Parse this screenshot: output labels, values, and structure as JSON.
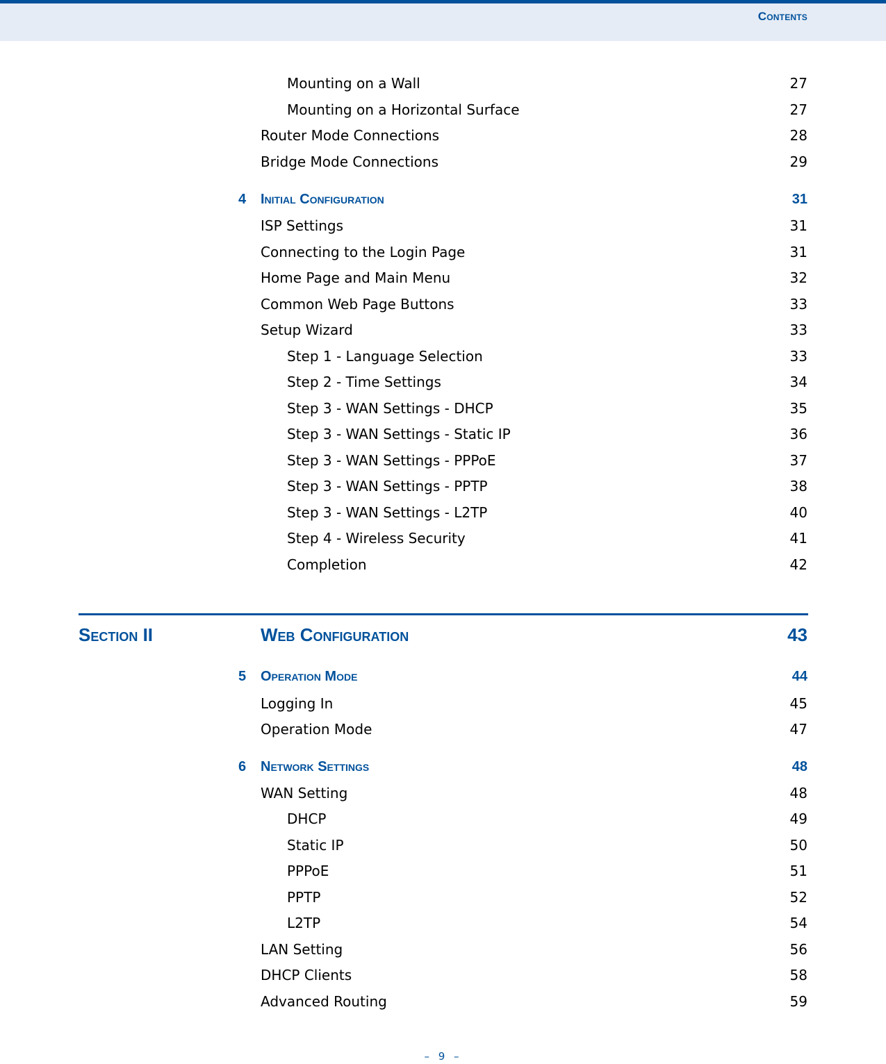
{
  "header": {
    "title": "Contents"
  },
  "toc_top": [
    {
      "level": 2,
      "label": "Mounting on a Wall",
      "page": "27"
    },
    {
      "level": 2,
      "label": "Mounting on a Horizontal Surface",
      "page": "27"
    },
    {
      "level": 1,
      "label": "Router Mode Connections",
      "page": "28"
    },
    {
      "level": 1,
      "label": "Bridge Mode Connections",
      "page": "29"
    }
  ],
  "chapter4": {
    "number": "4",
    "title": "Initial Configuration",
    "page": "31",
    "entries": [
      {
        "level": 1,
        "label": "ISP Settings",
        "page": "31"
      },
      {
        "level": 1,
        "label": "Connecting to the Login Page",
        "page": "31"
      },
      {
        "level": 1,
        "label": "Home Page and Main Menu",
        "page": "32"
      },
      {
        "level": 1,
        "label": "Common Web Page Buttons",
        "page": "33"
      },
      {
        "level": 1,
        "label": "Setup Wizard",
        "page": "33"
      },
      {
        "level": 2,
        "label": "Step 1 - Language Selection",
        "page": "33"
      },
      {
        "level": 2,
        "label": "Step 2 - Time Settings",
        "page": "34"
      },
      {
        "level": 2,
        "label": "Step 3 - WAN Settings - DHCP",
        "page": "35"
      },
      {
        "level": 2,
        "label": "Step 3 - WAN Settings - Static IP",
        "page": "36"
      },
      {
        "level": 2,
        "label": "Step 3 - WAN Settings - PPPoE",
        "page": "37"
      },
      {
        "level": 2,
        "label": "Step 3 - WAN Settings - PPTP",
        "page": "38"
      },
      {
        "level": 2,
        "label": "Step 3 - WAN Settings - L2TP",
        "page": "40"
      },
      {
        "level": 2,
        "label": "Step 4 - Wireless Security",
        "page": "41"
      },
      {
        "level": 2,
        "label": "Completion",
        "page": "42"
      }
    ]
  },
  "section2": {
    "label": "Section II",
    "title": "Web Configuration",
    "page": "43"
  },
  "chapter5": {
    "number": "5",
    "title": "Operation Mode",
    "page": "44",
    "entries": [
      {
        "level": 1,
        "label": "Logging In",
        "page": "45"
      },
      {
        "level": 1,
        "label": "Operation Mode",
        "page": "47"
      }
    ]
  },
  "chapter6": {
    "number": "6",
    "title": "Network Settings",
    "page": "48",
    "entries": [
      {
        "level": 1,
        "label": "WAN Setting",
        "page": "48"
      },
      {
        "level": 2,
        "label": "DHCP",
        "page": "49"
      },
      {
        "level": 2,
        "label": "Static IP",
        "page": "50"
      },
      {
        "level": 2,
        "label": "PPPoE",
        "page": "51"
      },
      {
        "level": 2,
        "label": "PPTP",
        "page": "52"
      },
      {
        "level": 2,
        "label": "L2TP",
        "page": "54"
      },
      {
        "level": 1,
        "label": "LAN Setting",
        "page": "56"
      },
      {
        "level": 1,
        "label": "DHCP Clients",
        "page": "58"
      },
      {
        "level": 1,
        "label": "Advanced Routing",
        "page": "59"
      }
    ]
  },
  "footer": {
    "page_number": "– 9 –"
  }
}
